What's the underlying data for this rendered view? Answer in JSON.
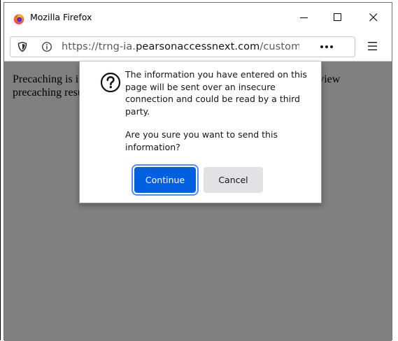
{
  "window": {
    "title": "Mozilla Firefox"
  },
  "urlbar": {
    "prefix": "https://trng-ia.",
    "host": "pearsonaccessnext.com",
    "path": "/customer/sessio"
  },
  "page": {
    "text": "Precaching is in progress. Please wait. You can return to the page to view precaching results."
  },
  "dialog": {
    "message": "The information you have entered on this page will be sent over an insecure connection and could be read by a third party.",
    "question": "Are you sure you want to send this information?",
    "continue_label": "Continue",
    "cancel_label": "Cancel"
  },
  "icons": {
    "app": "firefox-logo-icon",
    "shield": "tracking-protection-shield-icon",
    "info": "site-info-icon",
    "more": "page-actions-more-icon",
    "menu": "hamburger-menu-icon",
    "dialog": "question-mark-icon"
  },
  "colors": {
    "primary_button": "#0060df",
    "content_background": "#808080",
    "focus_ring": "#4d90fe"
  }
}
